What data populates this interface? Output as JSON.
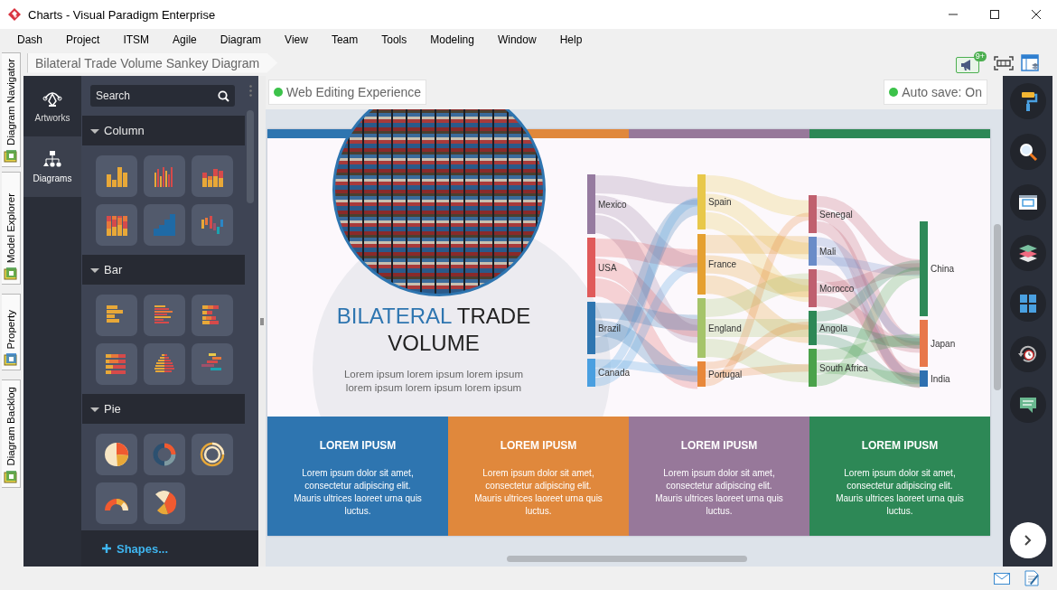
{
  "window": {
    "title": "Charts - Visual Paradigm Enterprise"
  },
  "menu": [
    "Dash",
    "Project",
    "ITSM",
    "Agile",
    "Diagram",
    "View",
    "Team",
    "Tools",
    "Modeling",
    "Window",
    "Help"
  ],
  "side_tabs": [
    {
      "label": "Diagram Navigator"
    },
    {
      "label": "Model Explorer"
    },
    {
      "label": "Property"
    },
    {
      "label": "Diagram Backlog"
    }
  ],
  "breadcrumb": "Bilateral Trade Volume Sankey Diagram",
  "notification_badge": "9+",
  "palette": {
    "categories": [
      {
        "label": "Artworks",
        "selected": false
      },
      {
        "label": "Diagrams",
        "selected": true
      }
    ],
    "search": {
      "placeholder": "Search"
    },
    "sections": [
      {
        "title": "Column",
        "kind": "column",
        "expanded": true
      },
      {
        "title": "Bar",
        "kind": "bar",
        "expanded": true
      },
      {
        "title": "Pie",
        "kind": "pie",
        "expanded": true
      }
    ],
    "more_link": "Shapes..."
  },
  "canvas": {
    "badges": [
      "Web Editing Experience",
      "Auto save: On"
    ],
    "infographic": {
      "title": {
        "accent": "BILATERAL",
        "rest": "TRADE VOLUME"
      },
      "subtitle": "Lorem ipsum lorem ipsum lorem ipsum lorem ipsum lorem ipsum lorem ipsum",
      "sankey": {
        "columns": [
          [
            {
              "name": "Mexico",
              "color": "#967ba0"
            },
            {
              "name": "USA",
              "color": "#e05a5a"
            },
            {
              "name": "Brazil",
              "color": "#2e75b0"
            },
            {
              "name": "Canada",
              "color": "#4a9fe0"
            }
          ],
          [
            {
              "name": "Spain",
              "color": "#e8c84a"
            },
            {
              "name": "France",
              "color": "#e5a030"
            },
            {
              "name": "England",
              "color": "#a5c46a"
            },
            {
              "name": "Portugal",
              "color": "#e8883a"
            }
          ],
          [
            {
              "name": "Senegal",
              "color": "#c0606e"
            },
            {
              "name": "Mali",
              "color": "#6a8cc8"
            },
            {
              "name": "Morocco",
              "color": "#bf5f6f"
            },
            {
              "name": "Angola",
              "color": "#2d8856"
            },
            {
              "name": "South Africa",
              "color": "#4aa24a"
            }
          ],
          [
            {
              "name": "China",
              "color": "#2e8a58"
            },
            {
              "name": "Japan",
              "color": "#e8784a"
            },
            {
              "name": "India",
              "color": "#2e70b0"
            }
          ]
        ]
      },
      "cards": [
        {
          "heading": "LOREM IPUSM",
          "body": "Lorem ipsum dolor sit amet, consectetur adipiscing elit. Mauris ultrices laoreet urna quis luctus.",
          "color": "#2e75b0"
        },
        {
          "heading": "LOREM IPUSM",
          "body": "Lorem ipsum dolor sit amet, consectetur adipiscing elit. Mauris ultrices laoreet urna quis luctus.",
          "color": "#e0883c"
        },
        {
          "heading": "LOREM IPUSM",
          "body": "Lorem ipsum dolor sit amet, consectetur adipiscing elit. Mauris ultrices laoreet urna quis luctus.",
          "color": "#97789a"
        },
        {
          "heading": "LOREM IPUSM",
          "body": "Lorem ipsum dolor sit amet, consectetur adipiscing elit. Mauris ultrices laoreet urna quis luctus.",
          "color": "#2d8856"
        }
      ]
    }
  }
}
